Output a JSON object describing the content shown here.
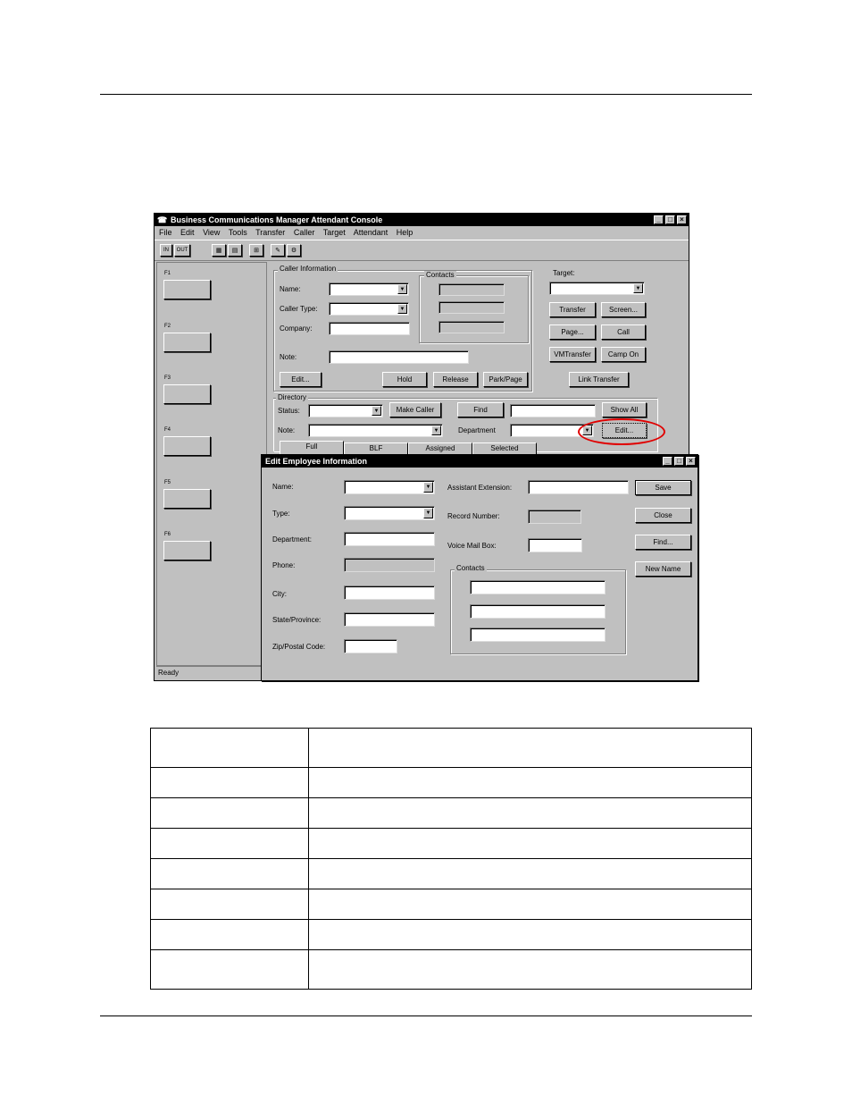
{
  "main_window": {
    "title": "Business Communications Manager Attendant Console",
    "menu": [
      "File",
      "Edit",
      "View",
      "Tools",
      "Transfer",
      "Caller",
      "Target",
      "Attendant",
      "Help"
    ],
    "toolbar": {
      "in_label": "IN",
      "out_label": "OUT"
    },
    "fkeys": [
      "F1",
      "F2",
      "F3",
      "F4",
      "F5",
      "F6"
    ],
    "caller_info": {
      "group_label": "Caller Information",
      "name_label": "Name:",
      "caller_type_label": "Caller Type:",
      "company_label": "Company:",
      "note_label": "Note:",
      "contacts_label": "Contacts",
      "edit_button": "Edit...",
      "hold_button": "Hold",
      "release_button": "Release",
      "park_page_button": "Park/Page"
    },
    "target": {
      "label": "Target:",
      "transfer_button": "Transfer",
      "screen_button": "Screen...",
      "page_button": "Page...",
      "call_button": "Call",
      "vm_transfer_button": "VMTransfer",
      "camp_on_button": "Camp On",
      "link_transfer_button": "Link Transfer"
    },
    "directory": {
      "group_label": "Directory",
      "status_label": "Status:",
      "make_caller_button": "Make Caller",
      "find_button": "Find",
      "show_all_button": "Show All",
      "note_label": "Note:",
      "department_label": "Department",
      "edit_button": "Edit...",
      "tabs": [
        "Full",
        "BLF",
        "Assigned",
        "Selected"
      ]
    },
    "status_bar": "Ready"
  },
  "edit_dialog": {
    "title": "Edit Employee Information",
    "name_label": "Name:",
    "type_label": "Type:",
    "department_label": "Department:",
    "phone_label": "Phone:",
    "city_label": "City:",
    "state_label": "State/Province:",
    "zip_label": "Zip/Postal Code:",
    "assistant_ext_label": "Assistant Extension:",
    "record_number_label": "Record Number:",
    "voice_mail_label": "Voice Mail Box:",
    "contacts_label": "Contacts",
    "save_button": "Save",
    "close_button": "Close",
    "find_button": "Find...",
    "new_name_button": "New Name"
  },
  "highlight_color": "#e00000"
}
